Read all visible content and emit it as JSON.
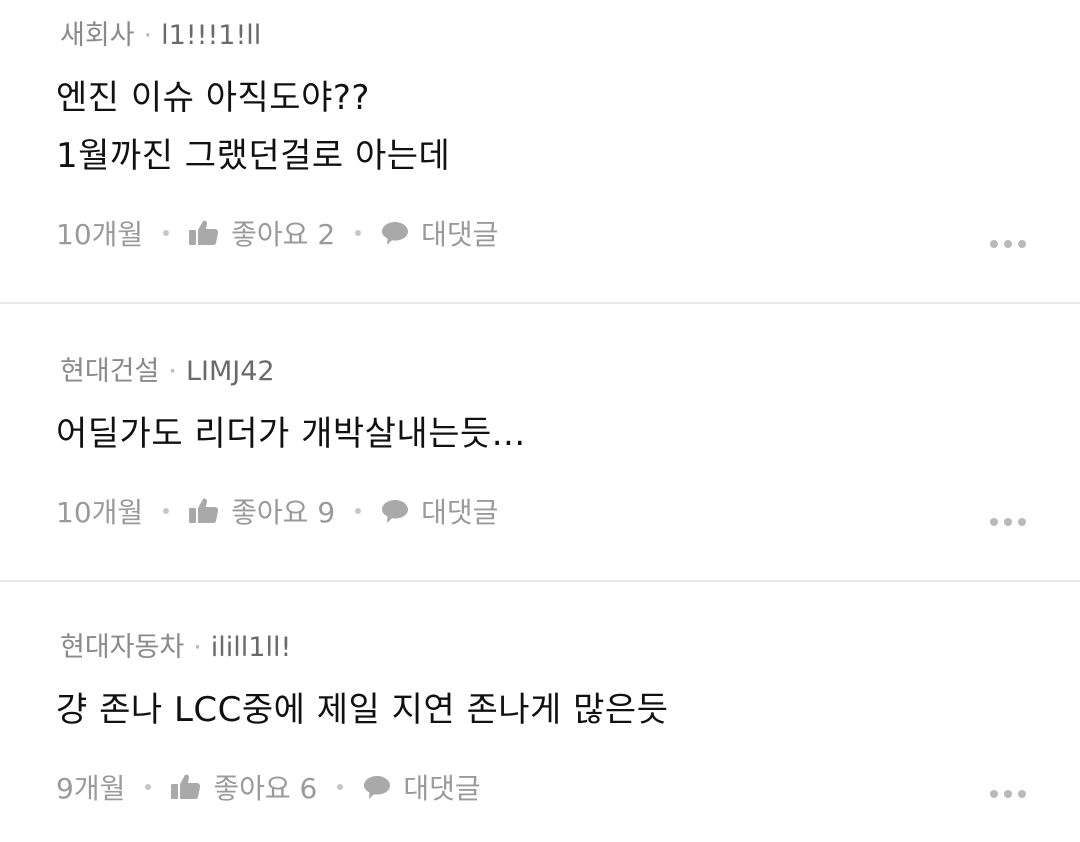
{
  "comments": [
    {
      "company": "새회사",
      "nickname": "l1!!!1!ll",
      "lines": [
        "엔진 이슈 아직도야??",
        "1월까진 그랬던걸로 아는데"
      ],
      "time": "10개월",
      "like_label": "좋아요 2",
      "reply_label": "대댓글"
    },
    {
      "company": "현대건설",
      "nickname": "LIMJ42",
      "lines": [
        "어딜가도 리더가 개박살내는듯..."
      ],
      "time": "10개월",
      "like_label": "좋아요 9",
      "reply_label": "대댓글"
    },
    {
      "company": "현대자동차",
      "nickname": "ilill1ll!",
      "lines": [
        "걍 존나 LCC중에 제일 지연 존나게 많은듯"
      ],
      "time": "9개월",
      "like_label": "좋아요 6",
      "reply_label": "대댓글"
    }
  ],
  "icons": {
    "like": "thumbs-up-icon",
    "reply": "speech-bubble-icon",
    "more": "more-dots-icon"
  },
  "colors": {
    "text": "#111111",
    "meta": "#9a9a9a",
    "icon": "#a9a9a9",
    "divider": "#e9e9e9"
  }
}
